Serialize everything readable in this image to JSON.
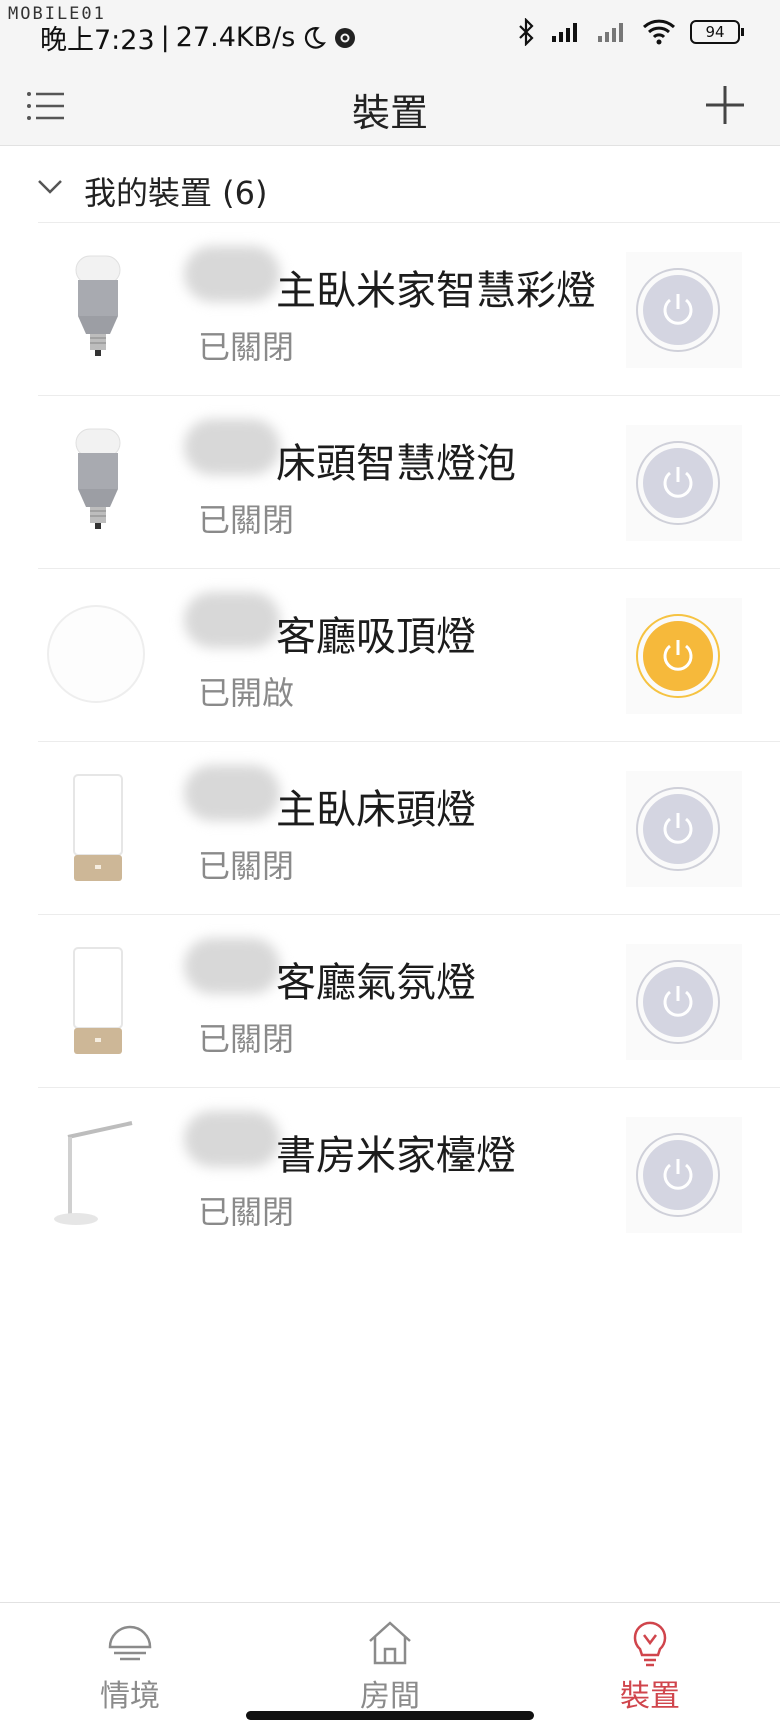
{
  "status": {
    "watermark": "MOBILE01",
    "time": "晚上7:23",
    "separator": "|",
    "speed": "27.4KB/s",
    "battery": "94",
    "icons": [
      "moon-icon",
      "chrome-icon",
      "bluetooth-icon",
      "signal-icon",
      "signal-icon",
      "wifi-icon",
      "battery-icon"
    ]
  },
  "header": {
    "title": "裝置"
  },
  "group": {
    "title": "我的裝置 (6)"
  },
  "devices": [
    {
      "name": "主臥米家智慧彩燈",
      "state": "已關閉",
      "on": false,
      "icon": "bulb-image"
    },
    {
      "name": "床頭智慧燈泡",
      "state": "已關閉",
      "on": false,
      "icon": "bulb-image"
    },
    {
      "name": "客廳吸頂燈",
      "state": "已開啟",
      "on": true,
      "icon": "ceiling-light-image"
    },
    {
      "name": "主臥床頭燈",
      "state": "已關閉",
      "on": false,
      "icon": "bedside-lamp-image"
    },
    {
      "name": "客廳氣氛燈",
      "state": "已關閉",
      "on": false,
      "icon": "bedside-lamp-image"
    },
    {
      "name": "書房米家檯燈",
      "state": "已關閉",
      "on": false,
      "icon": "desk-lamp-image"
    }
  ],
  "tabs": [
    {
      "label": "情境",
      "icon": "scene-lamp-icon",
      "active": false
    },
    {
      "label": "房間",
      "icon": "house-icon",
      "active": false
    },
    {
      "label": "裝置",
      "icon": "lightbulb-icon",
      "active": true
    }
  ],
  "colors": {
    "accent": "#d0454c",
    "power_on": "#f6b93b",
    "power_off": "#d4d5e1"
  }
}
